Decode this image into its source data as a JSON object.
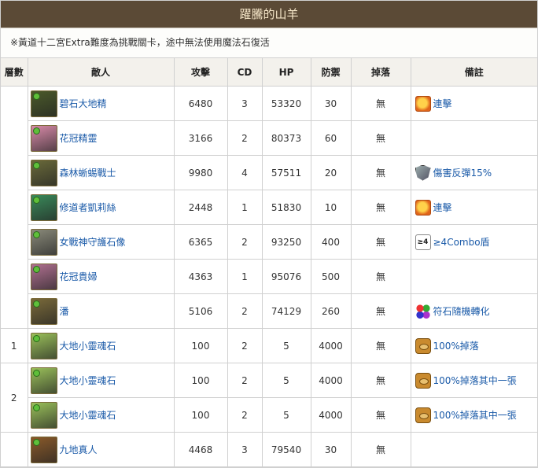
{
  "title": "躍騰的山羊",
  "note": "※黃道十二宮Extra難度為挑戰關卡，途中無法使用魔法石復活",
  "headers": [
    "層數",
    "敵人",
    "攻擊",
    "CD",
    "HP",
    "防禦",
    "掉落",
    "備註"
  ],
  "rows": [
    {
      "name": "碧石大地精",
      "atk": "6480",
      "cd": "3",
      "hp": "53320",
      "def": "30",
      "drop": "無",
      "note": "連擊",
      "icon": "combo-icon",
      "av": "#4b5a2a"
    },
    {
      "name": "花冠精靈",
      "atk": "3166",
      "cd": "2",
      "hp": "80373",
      "def": "60",
      "drop": "無",
      "note": "",
      "icon": "",
      "av": "#d88aa8"
    },
    {
      "name": "森林蜥蜴戰士",
      "atk": "9980",
      "cd": "4",
      "hp": "57511",
      "def": "20",
      "drop": "無",
      "note": "傷害反彈15%",
      "icon": "shield-icon",
      "av": "#6a6a3a"
    },
    {
      "name": "修道者凱莉絲",
      "atk": "2448",
      "cd": "1",
      "hp": "51830",
      "def": "10",
      "drop": "無",
      "note": "連擊",
      "icon": "combo-icon",
      "av": "#3a8a5a"
    },
    {
      "name": "女戰神守護石像",
      "atk": "6365",
      "cd": "2",
      "hp": "93250",
      "def": "400",
      "drop": "無",
      "note": "≥4Combo盾",
      "icon": "combo4-icon",
      "av": "#8a8a7a"
    },
    {
      "name": "花冠貴婦",
      "atk": "4363",
      "cd": "1",
      "hp": "95076",
      "def": "500",
      "drop": "無",
      "note": "",
      "icon": "",
      "av": "#b07090"
    },
    {
      "name": "潘",
      "atk": "5106",
      "cd": "2",
      "hp": "74129",
      "def": "260",
      "drop": "無",
      "note": "符石隨機轉化",
      "icon": "rune-icon",
      "av": "#7a6a3a"
    },
    {
      "name": "大地小靈魂石",
      "atk": "100",
      "cd": "2",
      "hp": "5",
      "def": "4000",
      "drop": "無",
      "note": "100%掉落",
      "icon": "drop-icon",
      "av": "#9ac05a"
    },
    {
      "name": "大地小靈魂石",
      "atk": "100",
      "cd": "2",
      "hp": "5",
      "def": "4000",
      "drop": "無",
      "note": "100%掉落其中一張",
      "icon": "drop-icon",
      "av": "#9ac05a"
    },
    {
      "name": "大地小靈魂石",
      "atk": "100",
      "cd": "2",
      "hp": "5",
      "def": "4000",
      "drop": "無",
      "note": "100%掉落其中一張",
      "icon": "drop-icon",
      "av": "#9ac05a"
    },
    {
      "name": "九地真人",
      "atk": "4468",
      "cd": "3",
      "hp": "79540",
      "def": "30",
      "drop": "無",
      "note": "",
      "icon": "",
      "av": "#8a5a2a"
    }
  ],
  "floors": [
    {
      "label": "",
      "span": 7
    },
    {
      "label": "1",
      "span": 1
    },
    {
      "label": "2",
      "span": 2
    },
    {
      "label": "",
      "span": 1
    }
  ]
}
